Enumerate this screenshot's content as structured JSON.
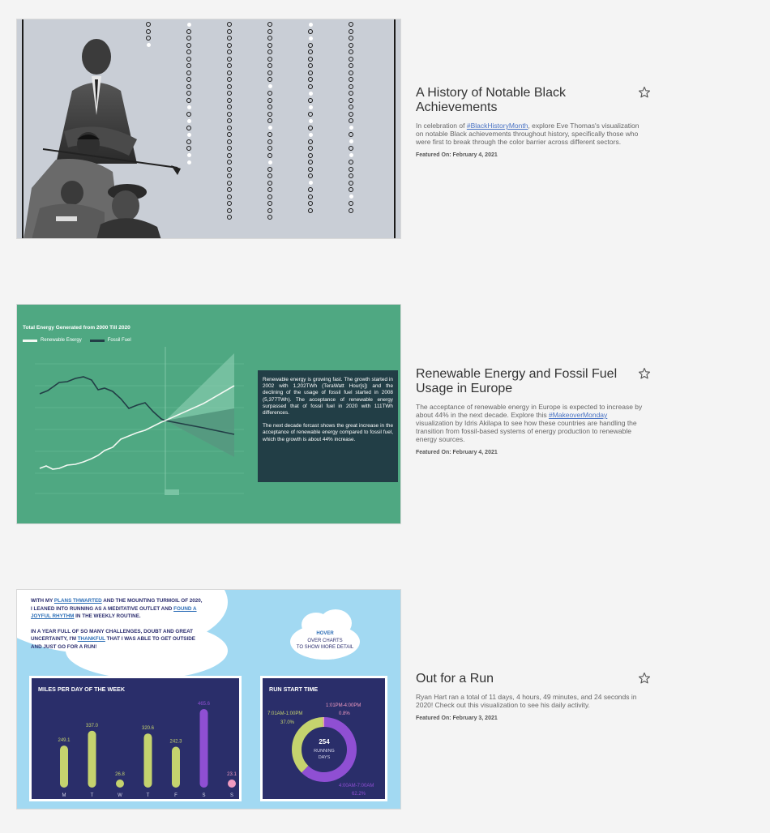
{
  "colors": {
    "page_bg": "#f4f4f4",
    "link": "#4a73c4",
    "energy_bg": "#4fa882",
    "renewable": "#f2f8f2",
    "fossil": "#223e46",
    "run_panel": "#2a2e6a",
    "run_bar": "#c5d36e",
    "run_bar_peak": "#8f4fd3",
    "run_bar_low": "#f19bc0",
    "sky": "#a2d9f2"
  },
  "icons": {
    "favorite": "star-outline-icon"
  },
  "cards": [
    {
      "title": "A History of Notable Black Achievements",
      "desc_before": "In celebration of ",
      "desc_tag": "#BlackHistoryMonth",
      "desc_after": ", explore Eve Thomas's visualization on notable Black achievements throughout history, specifically those who were first to break through the color barrier across different sectors.",
      "featured": "Featured On: February 4, 2021"
    },
    {
      "title": "Renewable Energy and Fossil Fuel Usage in Europe",
      "desc_before": "The acceptance of renewable energy in Europe is expected to increase by about 44% in the next decade. Explore this ",
      "desc_tag": "#MakeoverMonday",
      "desc_after": " visualization by Idris Akilapa to see how these countries are handling the transition from fossil-based systems of energy production to renewable energy sources.",
      "featured": "Featured On: February 4, 2021"
    },
    {
      "title": "Out for a Run",
      "desc_before": "Ryan Hart ran a total of 11 days, 4 hours, 49 minutes, and 24 seconds in 2020! Check out this visualization to see his daily activity.",
      "desc_tag": "",
      "desc_after": "",
      "featured": "Featured On: February 3, 2021"
    }
  ],
  "energy": {
    "chart_title": "Total Energy Generated from 2000 Till 2020",
    "legend_renewable": "Renewable Energy",
    "legend_fossil": "Fossil Fuel",
    "note_p1": "Renewable energy is growing fast. The growth started in 2002 with 1,202TWh (TeraWatt Hour[s]) and the declining of the usage of fossil fuel started in 2008 (5,377TWh). The acceptance of renewable energy surpassed that of fossil fuel in 2020 with 111TWh differences.",
    "note_p2": "The next decade forcast shows the great increase in the acceptance of renewable energy compared to fossil fuel, which the growth is about 44% increase."
  },
  "run": {
    "intro_1a": "With my ",
    "intro_1b": "plans thwarted",
    "intro_1c": " and the mounting turmoil of 2020, I leaned into running as a meditative outlet and ",
    "intro_1d": "found a joyful rhythm",
    "intro_1e": " in the weekly routine.",
    "intro_2a": "In a year full of so many challenges, doubt and great uncertainty, I'm ",
    "intro_2b": "thankful",
    "intro_2c": " that I was able to get outside and just go for a run!",
    "hover_key": "Hover",
    "hover_rest_1": "over charts",
    "hover_rest_2": "to show more detail",
    "miles_title": "MILES PER DAY OF THE WEEK",
    "start_title": "RUN START TIME",
    "donut_center_value": "254",
    "donut_center_l1": "RUNNING",
    "donut_center_l2": "DAYS",
    "donut_label_a1": "7:01AM-1:00PM",
    "donut_label_a2": "37.0%",
    "donut_label_b1": "1:01PM-4:00PM",
    "donut_label_b2": "0.8%",
    "donut_label_c1": "4:00AM-7:00AM",
    "donut_label_c2": "62.2%"
  },
  "chart_data": [
    {
      "type": "bar",
      "title": "MILES PER DAY OF THE WEEK",
      "categories": [
        "M",
        "T",
        "W",
        "T",
        "F",
        "S",
        "S"
      ],
      "values": [
        249.1,
        337.0,
        26.8,
        320.6,
        242.3,
        465.6,
        23.1
      ],
      "ylim": [
        0,
        480
      ]
    },
    {
      "type": "pie",
      "title": "RUN START TIME",
      "categories": [
        "4:00AM-7:00AM",
        "7:01AM-1:00PM",
        "1:01PM-4:00PM"
      ],
      "values": [
        62.2,
        37.0,
        0.8
      ]
    }
  ]
}
